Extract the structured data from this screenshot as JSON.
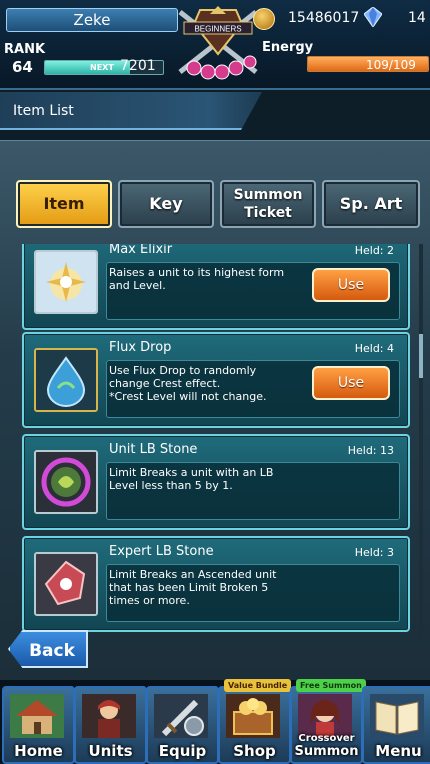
{
  "player": {
    "name": "Zeke",
    "rank_label": "RANK",
    "rank": "64",
    "next_label": "NEXT",
    "next_exp": "7201",
    "exp_fraction": 0.72,
    "emblem_text": "BEGINNERS"
  },
  "currency": {
    "coins": "15486017",
    "gems": "14"
  },
  "energy": {
    "label": "Energy",
    "value": "109/109",
    "fraction": 1.0
  },
  "page": {
    "title": "Item List"
  },
  "tabs": [
    {
      "label": "Item",
      "active": true
    },
    {
      "label": "Key",
      "active": false
    },
    {
      "label": "Summon",
      "label2": "Ticket",
      "active": false
    },
    {
      "label": "Sp. Art",
      "active": false
    }
  ],
  "items": [
    {
      "name": "Max Elixir",
      "held": "Held: 2",
      "desc": "Raises a unit to its highest form\nand Level.",
      "use": "Use",
      "icon": "elixir-icon"
    },
    {
      "name": "Flux Drop",
      "held": "Held: 4",
      "desc": "Use Flux Drop to randomly\nchange Crest effect.\n*Crest Level will not change.",
      "use": "Use",
      "icon": "flux-drop-icon"
    },
    {
      "name": "Unit LB Stone",
      "held": "Held: 13",
      "desc": "Limit Breaks a unit with an LB\nLevel less than 5 by 1.",
      "icon": "lb-stone-icon"
    },
    {
      "name": "Expert LB Stone",
      "held": "Held: 3",
      "desc": "Limit Breaks an Ascended unit\nthat has been Limit Broken 5\ntimes or more.",
      "icon": "expert-lb-stone-icon"
    }
  ],
  "back_label": "Back",
  "nav": [
    {
      "label": "Home",
      "icon": "home-icon"
    },
    {
      "label": "Units",
      "icon": "units-icon"
    },
    {
      "label": "Equip",
      "icon": "equip-icon"
    },
    {
      "label": "Shop",
      "icon": "shop-icon",
      "badge": "Value Bundle"
    },
    {
      "label": "Summon",
      "label_top": "Crossover",
      "icon": "summon-icon",
      "badge": "Free Summon"
    },
    {
      "label": "Menu",
      "icon": "menu-icon"
    }
  ],
  "colors": {
    "accent_gold": "#ffd24d",
    "card_border": "#6ed3e0",
    "use_button": "#e06a14"
  }
}
